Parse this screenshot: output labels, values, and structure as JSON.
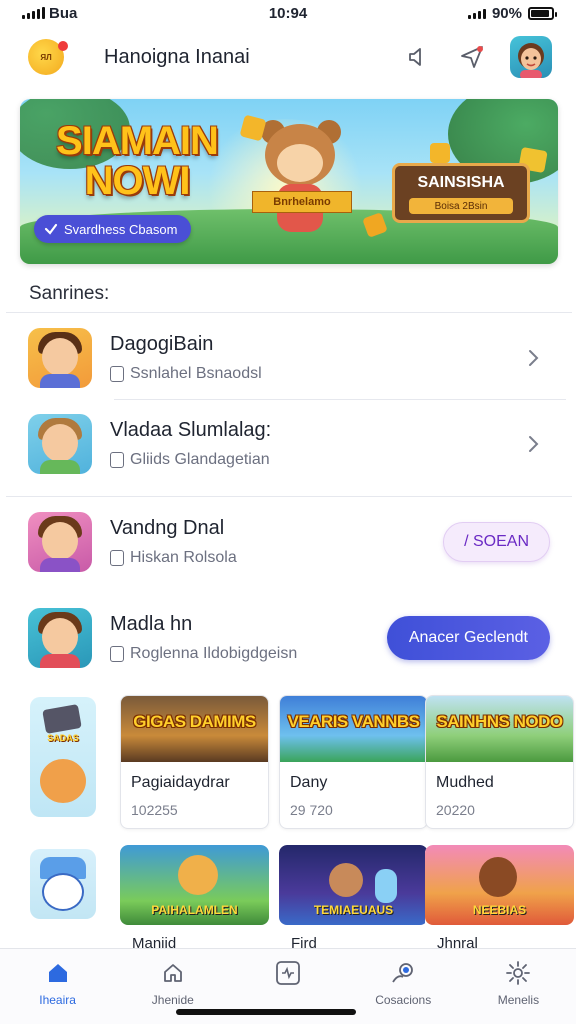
{
  "status_bar": {
    "carrier": "Bua",
    "time": "10:94",
    "battery": "90%",
    "battery_level": 0.9
  },
  "header": {
    "logo_text": "ЯЛ",
    "title": "Hanoigna Inanai",
    "icons": [
      "speaker-icon",
      "send-icon",
      "profile-avatar"
    ]
  },
  "banner": {
    "title": "SIAMAIN NOWI",
    "button_label": "Svardhess Cbasom",
    "ribbon_text": "Bnrhelamo",
    "sign_title": "SAINSISHA",
    "sign_subtitle": "Boisa 2Bsin"
  },
  "section": {
    "label": "Sanrines:"
  },
  "list": [
    {
      "title": "DagogiBain",
      "subtitle": "Ssnlahel Bsnaodsl",
      "action": "chevron-right-icon"
    },
    {
      "title": "Vladaa Slumlalag:",
      "subtitle": "Gliids Glandagetian",
      "action": "chevron-right-icon"
    }
  ],
  "list2": [
    {
      "title": "Vandng Dnal",
      "subtitle": "Hiskan Rolsola",
      "button": "/ SOEAN"
    },
    {
      "title": "Madla hn",
      "subtitle": "Roglenna Ildobigdgeisn",
      "button": "Anacer Geclendt"
    }
  ],
  "games_row1": [
    {
      "art_label": "GIGAS DAMIMS",
      "title": "Pagiaidaydrar",
      "number": "102255"
    },
    {
      "art_label": "VEARIS VANNBS",
      "title": "Dany",
      "number": "29 720"
    },
    {
      "art_label": "SAINHNS NODO",
      "title": "Mudhed",
      "number": "20220"
    }
  ],
  "side_cards": [
    {
      "label": "SADAS"
    },
    {
      "label": ""
    }
  ],
  "games_row2": [
    {
      "art_label": "PAIHALAMLEN",
      "title": "Maniid"
    },
    {
      "art_label": "TEMIAEUAUS",
      "title": "Fird"
    },
    {
      "art_label": "NEEBIAS",
      "title": "Jhnral"
    }
  ],
  "bottom_nav": [
    {
      "label": "Iheaira",
      "icon": "home-icon",
      "active": true
    },
    {
      "label": "Jhenide",
      "icon": "house-outline-icon",
      "active": false
    },
    {
      "label": "",
      "icon": "activity-icon",
      "active": false
    },
    {
      "label": "Cosacions",
      "icon": "search-user-icon",
      "active": false
    },
    {
      "label": "Menelis",
      "icon": "gear-icon",
      "active": false
    }
  ],
  "colors": {
    "accent": "#4a4fd6",
    "active_nav": "#2d6ae0",
    "soft_button": "#f5ebfc"
  }
}
